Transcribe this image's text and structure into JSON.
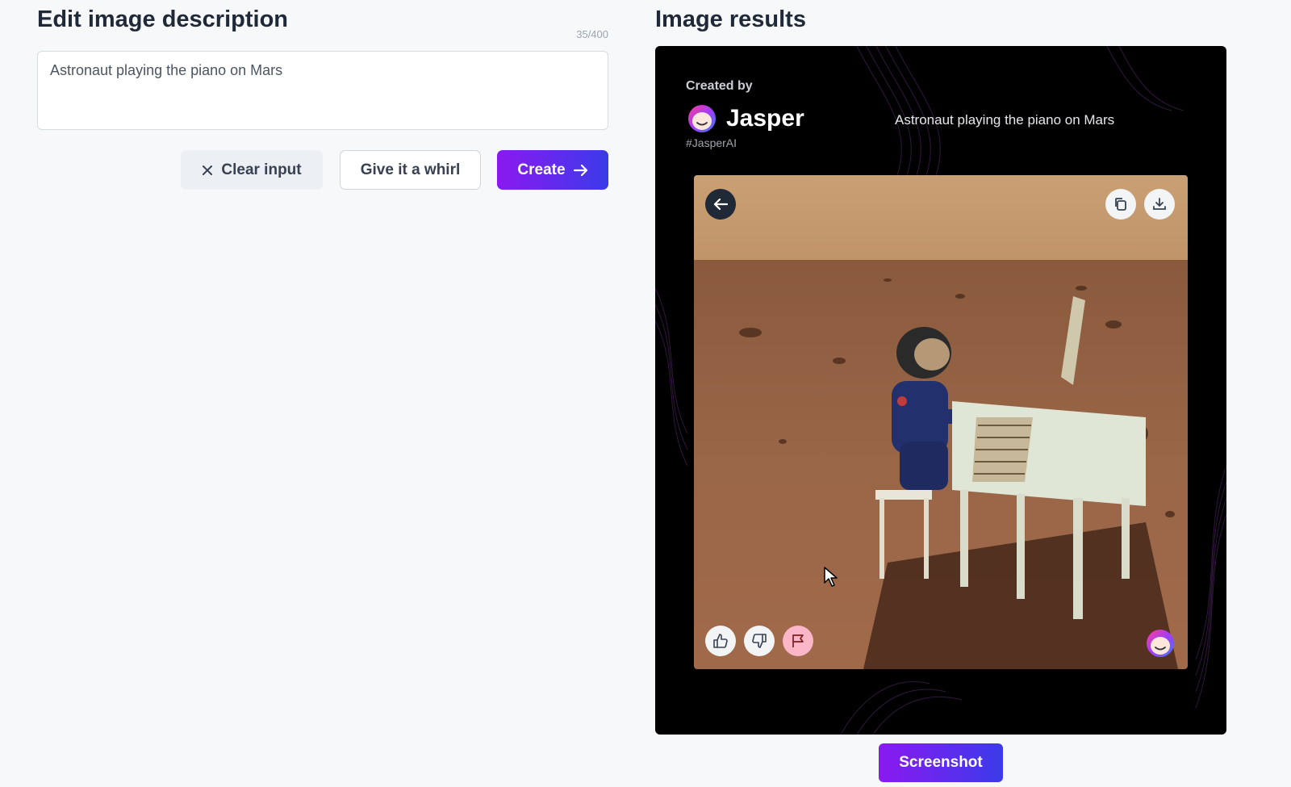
{
  "editor": {
    "title": "Edit image description",
    "counter": "35/400",
    "input_value": "Astronaut playing the piano on Mars",
    "clear_label": "Clear input",
    "whirl_label": "Give it a whirl",
    "create_label": "Create"
  },
  "results": {
    "title": "Image results",
    "created_by": "Created by",
    "brand": "Jasper",
    "hashtag": "#JasperAI",
    "caption": "Astronaut playing the piano on Mars",
    "screenshot_label": "Screenshot"
  },
  "colors": {
    "accent_start": "#8b19f0",
    "accent_end": "#3b3be8",
    "card_bg": "#000000"
  },
  "icons": [
    "close-icon",
    "arrow-right-icon",
    "arrow-left-icon",
    "copy-icon",
    "download-icon",
    "thumbs-up-icon",
    "thumbs-down-icon",
    "flag-icon",
    "jasper-logo-icon",
    "cursor-icon"
  ]
}
